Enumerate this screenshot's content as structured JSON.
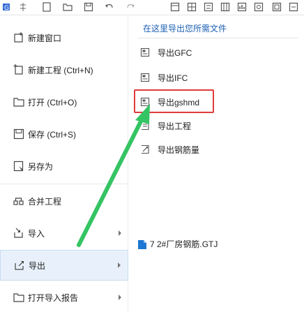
{
  "toolbar": {
    "icons": [
      "app-logo-icon",
      "pin-icon",
      "new-file-icon",
      "open-folder-icon",
      "save-icon",
      "undo-icon",
      "redo-icon",
      "layout-icon",
      "grid-icon",
      "list-icon",
      "table-icon",
      "settings-icon"
    ]
  },
  "left_menu": {
    "items": [
      {
        "label": "新建窗口",
        "icon": "new-window-icon"
      },
      {
        "label": "新建工程 (Ctrl+N)",
        "icon": "new-project-icon"
      },
      {
        "label": "打开 (Ctrl+O)",
        "icon": "open-folder-icon"
      },
      {
        "label": "保存 (Ctrl+S)",
        "icon": "save-icon"
      },
      {
        "label": "另存为",
        "icon": "save-as-icon"
      },
      {
        "label": "合并工程",
        "icon": "merge-icon"
      },
      {
        "label": "导入",
        "icon": "import-icon"
      },
      {
        "label": "导出",
        "icon": "export-icon"
      },
      {
        "label": "打开导入报告",
        "icon": "open-report-icon"
      }
    ]
  },
  "right_panel": {
    "header": "在这里导出您所需文件",
    "items": [
      {
        "label": "导出GFC",
        "icon": "export-gfc-icon"
      },
      {
        "label": "导出IFC",
        "icon": "export-ifc-icon"
      },
      {
        "label": "导出gshmd",
        "icon": "export-gshmd-icon"
      },
      {
        "label": "导出工程",
        "icon": "export-project-icon"
      },
      {
        "label": "导出钢筋量",
        "icon": "export-rebar-icon"
      }
    ],
    "recent": {
      "label": "7 2#厂房钢筋.GTJ",
      "icon": "gtj-file-icon"
    }
  },
  "colors": {
    "accent_blue": "#1b5fb3",
    "highlight_red": "#e03a3a",
    "arrow_green": "#35c463",
    "active_bg": "#e8f1fb"
  }
}
